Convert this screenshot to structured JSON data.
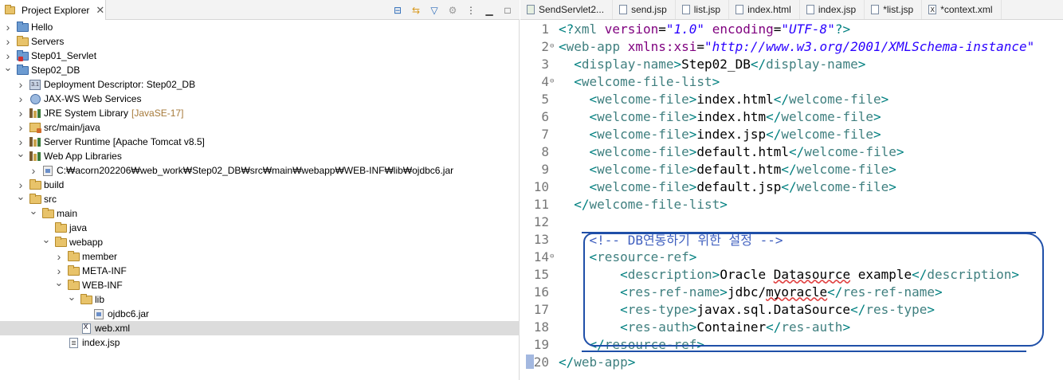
{
  "explorer": {
    "tab_label": "Project Explorer",
    "tree": [
      {
        "depth": 0,
        "twisty": ">",
        "icon": "project",
        "label": "Hello"
      },
      {
        "depth": 0,
        "twisty": ">",
        "icon": "folder",
        "label": "Servers"
      },
      {
        "depth": 0,
        "twisty": ">",
        "icon": "project-error",
        "label": "Step01_Servlet"
      },
      {
        "depth": 0,
        "twisty": "v",
        "icon": "project",
        "label": "Step02_DB"
      },
      {
        "depth": 1,
        "twisty": ">",
        "icon": "deployment-descriptor",
        "label": "Deployment Descriptor: Step02_DB"
      },
      {
        "depth": 1,
        "twisty": ">",
        "icon": "web-services",
        "label": "JAX-WS Web Services"
      },
      {
        "depth": 1,
        "twisty": ">",
        "icon": "library",
        "label": "JRE System Library",
        "decor": "[JavaSE-17]"
      },
      {
        "depth": 1,
        "twisty": ">",
        "icon": "source-folder",
        "label": "src/main/java"
      },
      {
        "depth": 1,
        "twisty": ">",
        "icon": "library",
        "label": "Server Runtime [Apache Tomcat v8.5]"
      },
      {
        "depth": 1,
        "twisty": "v",
        "icon": "library",
        "label": "Web App Libraries"
      },
      {
        "depth": 2,
        "twisty": ">",
        "icon": "jar",
        "label": "C:₩acorn202206₩web_work₩Step02_DB₩src₩main₩webapp₩WEB-INF₩lib₩ojdbc6.jar"
      },
      {
        "depth": 1,
        "twisty": ">",
        "icon": "folder",
        "label": "build"
      },
      {
        "depth": 1,
        "twisty": "v",
        "icon": "folder",
        "label": "src"
      },
      {
        "depth": 2,
        "twisty": "v",
        "icon": "folder",
        "label": "main"
      },
      {
        "depth": 3,
        "twisty": "",
        "icon": "folder",
        "label": "java"
      },
      {
        "depth": 3,
        "twisty": "v",
        "icon": "folder",
        "label": "webapp"
      },
      {
        "depth": 4,
        "twisty": ">",
        "icon": "folder",
        "label": "member"
      },
      {
        "depth": 4,
        "twisty": ">",
        "icon": "folder",
        "label": "META-INF"
      },
      {
        "depth": 4,
        "twisty": "v",
        "icon": "folder",
        "label": "WEB-INF"
      },
      {
        "depth": 5,
        "twisty": "v",
        "icon": "folder",
        "label": "lib"
      },
      {
        "depth": 6,
        "twisty": "",
        "icon": "jar",
        "label": "ojdbc6.jar"
      },
      {
        "depth": 5,
        "twisty": "",
        "icon": "xml-file",
        "label": "web.xml",
        "selected": true
      },
      {
        "depth": 4,
        "twisty": "",
        "icon": "jsp-file",
        "label": "index.jsp"
      }
    ]
  },
  "editor": {
    "tabs": [
      {
        "label": "SendServlet2...",
        "icon": "java-file"
      },
      {
        "label": "send.jsp",
        "icon": "jsp-file"
      },
      {
        "label": "list.jsp",
        "icon": "jsp-file"
      },
      {
        "label": "index.html",
        "icon": "html-file"
      },
      {
        "label": "index.jsp",
        "icon": "jsp-file"
      },
      {
        "label": "*list.jsp",
        "icon": "jsp-file"
      },
      {
        "label": "*context.xml",
        "icon": "xml-file"
      }
    ],
    "lines": [
      {
        "n": "1",
        "fold": "",
        "indent": "",
        "parts": [
          [
            "b",
            "<?"
          ],
          [
            "t",
            "xml "
          ],
          [
            "a",
            "version"
          ],
          [
            "x",
            "="
          ],
          [
            "v",
            "\"1.0\""
          ],
          [
            "x",
            " "
          ],
          [
            "a",
            "encoding"
          ],
          [
            "x",
            "="
          ],
          [
            "v",
            "\"UTF-8\""
          ],
          [
            "b",
            "?>"
          ]
        ]
      },
      {
        "n": "2",
        "fold": "⊖",
        "indent": "",
        "parts": [
          [
            "b",
            "<"
          ],
          [
            "t",
            "web-app "
          ],
          [
            "a",
            "xmlns:xsi"
          ],
          [
            "x",
            "="
          ],
          [
            "v",
            "\"http://www.w3.org/2001/XMLSchema-instance\""
          ]
        ]
      },
      {
        "n": "3",
        "fold": "",
        "indent": "  ",
        "parts": [
          [
            "b",
            "<"
          ],
          [
            "t",
            "display-name"
          ],
          [
            "b",
            ">"
          ],
          [
            "x",
            "Step02_DB"
          ],
          [
            "b",
            "</"
          ],
          [
            "t",
            "display-name"
          ],
          [
            "b",
            ">"
          ]
        ]
      },
      {
        "n": "4",
        "fold": "⊖",
        "indent": "  ",
        "parts": [
          [
            "b",
            "<"
          ],
          [
            "t",
            "welcome-file-list"
          ],
          [
            "b",
            ">"
          ]
        ]
      },
      {
        "n": "5",
        "fold": "",
        "indent": "    ",
        "parts": [
          [
            "b",
            "<"
          ],
          [
            "t",
            "welcome-file"
          ],
          [
            "b",
            ">"
          ],
          [
            "x",
            "index.html"
          ],
          [
            "b",
            "</"
          ],
          [
            "t",
            "welcome-file"
          ],
          [
            "b",
            ">"
          ]
        ]
      },
      {
        "n": "6",
        "fold": "",
        "indent": "    ",
        "parts": [
          [
            "b",
            "<"
          ],
          [
            "t",
            "welcome-file"
          ],
          [
            "b",
            ">"
          ],
          [
            "x",
            "index.htm"
          ],
          [
            "b",
            "</"
          ],
          [
            "t",
            "welcome-file"
          ],
          [
            "b",
            ">"
          ]
        ]
      },
      {
        "n": "7",
        "fold": "",
        "indent": "    ",
        "parts": [
          [
            "b",
            "<"
          ],
          [
            "t",
            "welcome-file"
          ],
          [
            "b",
            ">"
          ],
          [
            "x",
            "index.jsp"
          ],
          [
            "b",
            "</"
          ],
          [
            "t",
            "welcome-file"
          ],
          [
            "b",
            ">"
          ]
        ]
      },
      {
        "n": "8",
        "fold": "",
        "indent": "    ",
        "parts": [
          [
            "b",
            "<"
          ],
          [
            "t",
            "welcome-file"
          ],
          [
            "b",
            ">"
          ],
          [
            "x",
            "default.html"
          ],
          [
            "b",
            "</"
          ],
          [
            "t",
            "welcome-file"
          ],
          [
            "b",
            ">"
          ]
        ]
      },
      {
        "n": "9",
        "fold": "",
        "indent": "    ",
        "parts": [
          [
            "b",
            "<"
          ],
          [
            "t",
            "welcome-file"
          ],
          [
            "b",
            ">"
          ],
          [
            "x",
            "default.htm"
          ],
          [
            "b",
            "</"
          ],
          [
            "t",
            "welcome-file"
          ],
          [
            "b",
            ">"
          ]
        ]
      },
      {
        "n": "10",
        "fold": "",
        "indent": "    ",
        "parts": [
          [
            "b",
            "<"
          ],
          [
            "t",
            "welcome-file"
          ],
          [
            "b",
            ">"
          ],
          [
            "x",
            "default.jsp"
          ],
          [
            "b",
            "</"
          ],
          [
            "t",
            "welcome-file"
          ],
          [
            "b",
            ">"
          ]
        ]
      },
      {
        "n": "11",
        "fold": "",
        "indent": "  ",
        "parts": [
          [
            "b",
            "</"
          ],
          [
            "t",
            "welcome-file-list"
          ],
          [
            "b",
            ">"
          ]
        ]
      },
      {
        "n": "12",
        "fold": "",
        "indent": "",
        "parts": []
      },
      {
        "n": "13",
        "fold": "",
        "indent": "    ",
        "parts": [
          [
            "c",
            "<!-- DB연동하기 위한 설정 -->"
          ]
        ]
      },
      {
        "n": "14",
        "fold": "⊖",
        "indent": "    ",
        "parts": [
          [
            "b",
            "<"
          ],
          [
            "t",
            "resource-ref"
          ],
          [
            "b",
            ">"
          ]
        ]
      },
      {
        "n": "15",
        "fold": "",
        "indent": "        ",
        "parts": [
          [
            "b",
            "<"
          ],
          [
            "t",
            "description"
          ],
          [
            "b",
            ">"
          ],
          [
            "x",
            "Oracle "
          ],
          [
            "s",
            "Datasource"
          ],
          [
            "x",
            " example"
          ],
          [
            "b",
            "</"
          ],
          [
            "t",
            "description"
          ],
          [
            "b",
            ">"
          ]
        ]
      },
      {
        "n": "16",
        "fold": "",
        "indent": "        ",
        "parts": [
          [
            "b",
            "<"
          ],
          [
            "t",
            "res-ref-name"
          ],
          [
            "b",
            ">"
          ],
          [
            "x",
            "jdbc/"
          ],
          [
            "s",
            "myoracle"
          ],
          [
            "b",
            "</"
          ],
          [
            "t",
            "res-ref-name"
          ],
          [
            "b",
            ">"
          ]
        ]
      },
      {
        "n": "17",
        "fold": "",
        "indent": "        ",
        "parts": [
          [
            "b",
            "<"
          ],
          [
            "t",
            "res-type"
          ],
          [
            "b",
            ">"
          ],
          [
            "x",
            "javax.sql.DataSource"
          ],
          [
            "b",
            "</"
          ],
          [
            "t",
            "res-type"
          ],
          [
            "b",
            ">"
          ]
        ]
      },
      {
        "n": "18",
        "fold": "",
        "indent": "        ",
        "parts": [
          [
            "b",
            "<"
          ],
          [
            "t",
            "res-auth"
          ],
          [
            "b",
            ">"
          ],
          [
            "x",
            "Container"
          ],
          [
            "b",
            "</"
          ],
          [
            "t",
            "res-auth"
          ],
          [
            "b",
            ">"
          ]
        ]
      },
      {
        "n": "19",
        "fold": "",
        "indent": "    ",
        "parts": [
          [
            "b",
            "</"
          ],
          [
            "t",
            "resource-ref"
          ],
          [
            "b",
            ">"
          ]
        ]
      },
      {
        "n": "20",
        "fold": "",
        "indent": "",
        "parts": [
          [
            "b",
            "</"
          ],
          [
            "t",
            "web-app"
          ],
          [
            "b",
            ">"
          ]
        ]
      }
    ]
  },
  "colors": {
    "annotation": "#1f4fa8",
    "tag": "#3f7f7f",
    "attribute": "#7f007f",
    "value": "#2a00ff",
    "comment": "#3f5fbf"
  }
}
